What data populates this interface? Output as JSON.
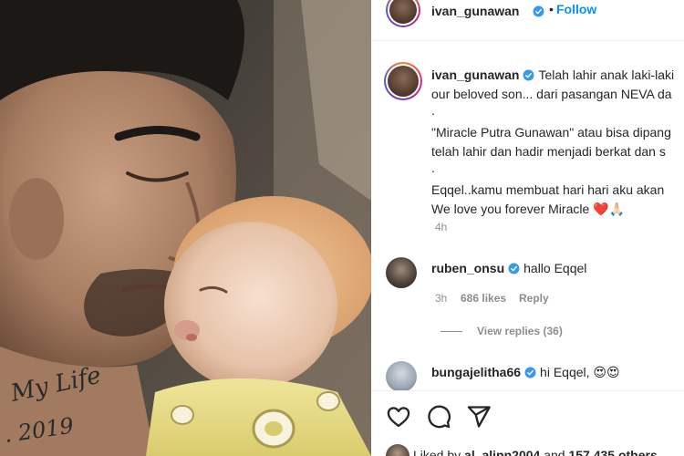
{
  "header": {
    "username": "ivan_gunawan",
    "dot": "•",
    "follow_label": "Follow"
  },
  "caption": {
    "username": "ivan_gunawan",
    "lines": [
      "Telah lahir anak laki-laki",
      "our beloved son... dari pasangan NEVA da",
      ".",
      "\"Miracle Putra Gunawan\" atau bisa dipang",
      "telah lahir dan hadir menjadi berkat dan s",
      ".",
      "Eqqel..kamu membuat hari hari aku akan",
      "We love you forever Miracle ❤️🙏🏻"
    ],
    "time": "4h"
  },
  "comments": [
    {
      "username": "ruben_onsu",
      "text": "hallo Eqqel",
      "time": "3h",
      "likes": "686 likes",
      "reply_label": "Reply",
      "view_replies": "View replies (36)"
    },
    {
      "username": "bungajelitha66",
      "text": "hi Eqqel, 😍😍"
    }
  ],
  "actions": {
    "icons": [
      "heart-icon",
      "comment-icon",
      "share-icon"
    ],
    "liked_prefix": "Liked by ",
    "liked_user": "al_alinn2004",
    "liked_middle": " and ",
    "liked_count": "157,435 others"
  },
  "colors": {
    "accent": "#0095f6",
    "verified": "#3897f0",
    "muted": "#8e8e8e",
    "text": "#262626"
  }
}
